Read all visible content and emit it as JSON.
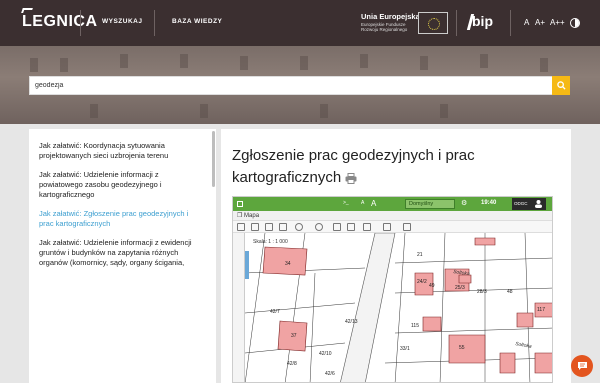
{
  "header": {
    "logo": "LEGNICA",
    "nav": [
      "WYSZUKAJ",
      "BAZA WIEDZY"
    ],
    "eu": {
      "title": "Unia Europejska",
      "subtitle": "Europejskie Fundusze Rozwoju Regionalnego"
    },
    "bip": "bip",
    "font_sizes": [
      "A",
      "A+",
      "A++"
    ],
    "icons": [
      "eu-flag-icon",
      "bip-icon",
      "contrast-icon"
    ]
  },
  "search": {
    "value": "geodezja",
    "button_icon": "search-icon",
    "button_color": "#f5b915"
  },
  "sidebar": {
    "items": [
      {
        "label": "Jak załatwić: Koordynacja sytuowania projektowanych sieci uzbrojenia terenu",
        "active": false
      },
      {
        "label": "Jak załatwić: Udzielenie informacji z powiatowego zasobu geodezyjnego i kartograficznego",
        "active": false
      },
      {
        "label": "Jak załatwić: Zgłoszenie prac geodezyjnych i prac kartograficznych",
        "active": true
      },
      {
        "label": "Jak załatwić: Udzielenie informacji z ewidencji gruntów i budynków na zapytania różnych organów (komornicy, sądy, organy ścigania,",
        "active": false
      }
    ],
    "active_color": "#3d9fd0"
  },
  "main": {
    "title": "Zgłoszenie prac geodezyjnych i prac kartograficznych",
    "print_icon": "print-icon"
  },
  "map": {
    "title": "Mapa",
    "select_value": "Domyślny",
    "time": "19:40",
    "user": "ODGC",
    "scale": "Skala: 1 : 1 000",
    "street_labels": [
      "Soltoka",
      "Sołtoka"
    ],
    "parcel_labels": [
      "34",
      "21",
      "24/2",
      "49",
      "25/3",
      "28/3",
      "37",
      "42/7",
      "42/10",
      "42/8",
      "42/13",
      "42/6",
      "33/1",
      "55",
      "115",
      "117",
      "48"
    ]
  },
  "chat": {
    "icon": "chat-icon",
    "color": "#e3551f"
  }
}
